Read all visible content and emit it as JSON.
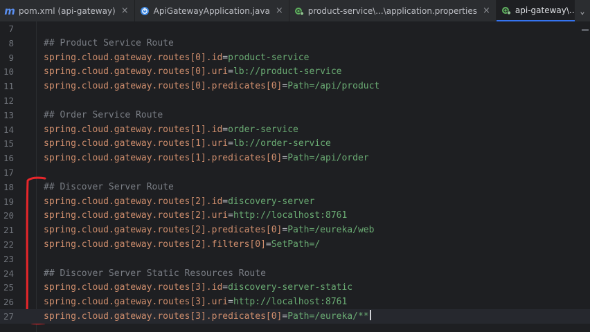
{
  "tabs": [
    {
      "label": "pom.xml (api-gateway)",
      "icon": "maven-icon",
      "active": false
    },
    {
      "label": "ApiGatewayApplication.java",
      "icon": "spring-boot-icon",
      "active": false
    },
    {
      "label": "product-service\\...\\application.properties",
      "icon": "spring-properties-icon",
      "active": false
    },
    {
      "label": "api-gateway\\...\\application.properties",
      "icon": "spring-properties-icon",
      "active": true
    }
  ],
  "lines": [
    {
      "n": "7",
      "type": "blank"
    },
    {
      "n": "8",
      "type": "comment",
      "text": "## Product Service Route"
    },
    {
      "n": "9",
      "type": "prop",
      "key": "spring.cloud.gateway.routes[0].id",
      "value": "product-service"
    },
    {
      "n": "10",
      "type": "prop",
      "key": "spring.cloud.gateway.routes[0].uri",
      "value": "lb://product-service"
    },
    {
      "n": "11",
      "type": "prop",
      "key": "spring.cloud.gateway.routes[0].predicates[0]",
      "value": "Path=/api/product"
    },
    {
      "n": "12",
      "type": "blank"
    },
    {
      "n": "13",
      "type": "comment",
      "text": "## Order Service Route"
    },
    {
      "n": "14",
      "type": "prop",
      "key": "spring.cloud.gateway.routes[1].id",
      "value": "order-service"
    },
    {
      "n": "15",
      "type": "prop",
      "key": "spring.cloud.gateway.routes[1].uri",
      "value": "lb://order-service"
    },
    {
      "n": "16",
      "type": "prop",
      "key": "spring.cloud.gateway.routes[1].predicates[0]",
      "value": "Path=/api/order"
    },
    {
      "n": "17",
      "type": "blank"
    },
    {
      "n": "18",
      "type": "comment",
      "text": "## Discover Server Route"
    },
    {
      "n": "19",
      "type": "prop",
      "key": "spring.cloud.gateway.routes[2].id",
      "value": "discovery-server"
    },
    {
      "n": "20",
      "type": "prop",
      "key": "spring.cloud.gateway.routes[2].uri",
      "value": "http://localhost:8761"
    },
    {
      "n": "21",
      "type": "prop",
      "key": "spring.cloud.gateway.routes[2].predicates[0]",
      "value": "Path=/eureka/web"
    },
    {
      "n": "22",
      "type": "prop",
      "key": "spring.cloud.gateway.routes[2].filters[0]",
      "value": "SetPath=/"
    },
    {
      "n": "23",
      "type": "blank"
    },
    {
      "n": "24",
      "type": "comment",
      "text": "## Discover Server Static Resources Route"
    },
    {
      "n": "25",
      "type": "prop",
      "key": "spring.cloud.gateway.routes[3].id",
      "value": "discovery-server-static"
    },
    {
      "n": "26",
      "type": "prop",
      "key": "spring.cloud.gateway.routes[3].uri",
      "value": "http://localhost:8761"
    },
    {
      "n": "27",
      "type": "prop",
      "key": "spring.cloud.gateway.routes[3].predicates[0]",
      "value": "Path=/eureka/**",
      "current": true
    }
  ],
  "colors": {
    "annotation": "#e8262b",
    "accent": "#3574f0"
  }
}
